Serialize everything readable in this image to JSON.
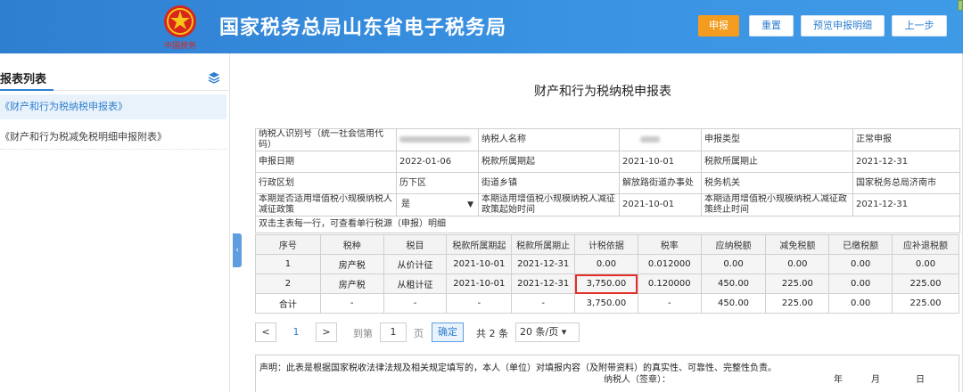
{
  "header": {
    "title": "国家税务总局山东省电子税务局",
    "emblem_text": "中国税务",
    "buttons": [
      {
        "label": "申报"
      },
      {
        "label": "重置"
      },
      {
        "label": "预览申报明细"
      },
      {
        "label": "上一步"
      }
    ]
  },
  "sidebar": {
    "title": "报表列表",
    "items": [
      {
        "label": "《财产和行为税纳税申报表》"
      },
      {
        "label": "《财产和行为税减免税明细申报附表》"
      }
    ]
  },
  "form": {
    "title": "财产和行为税纳税申报表",
    "info": {
      "taxpayer_id_label": "纳税人识别号（统一社会信用代码）",
      "taxpayer_name_label": "纳税人名称",
      "declare_type_label": "申报类型",
      "declare_type_value": "正常申报",
      "declare_date_label": "申报日期",
      "declare_date_value": "2022-01-06",
      "period_start_label": "税款所属期起",
      "period_start_value": "2021-10-01",
      "period_end_label": "税款所属期止",
      "period_end_value": "2021-12-31",
      "district_label": "行政区划",
      "district_value": "历下区",
      "street_label": "街道乡镇",
      "street_value": "解放路街道办事处",
      "authority_label": "税务机关",
      "authority_value": "国家税务总局济南市",
      "small_scale_label": "本期是否适用增值税小规模纳税人减征政策",
      "small_scale_value": "是",
      "reduce_start_label": "本期适用增值税小规模纳税人减征政策起始时间",
      "reduce_start_value": "2021-10-01",
      "reduce_end_label": "本期适用增值税小规模纳税人减征政策终止时间",
      "reduce_end_value": "2021-12-31",
      "hint": "双击主表每一行，可查看单行税源（申报）明细"
    },
    "grid": {
      "headers": [
        "序号",
        "税种",
        "税目",
        "税款所属期起",
        "税款所属期止",
        "计税依据",
        "税率",
        "应纳税额",
        "减免税额",
        "已缴税额",
        "应补退税额"
      ],
      "rows": [
        [
          "1",
          "房产税",
          "从价计征",
          "2021-10-01",
          "2021-12-31",
          "0.00",
          "0.012000",
          "0.00",
          "0.00",
          "0.00",
          "0.00"
        ],
        [
          "2",
          "房产税",
          "从租计征",
          "2021-10-01",
          "2021-12-31",
          "3,750.00",
          "0.120000",
          "450.00",
          "225.00",
          "0.00",
          "225.00"
        ],
        [
          "合计",
          "-",
          "-",
          "-",
          "-",
          "3,750.00",
          "-",
          "450.00",
          "225.00",
          "0.00",
          "225.00"
        ]
      ]
    },
    "pager": {
      "prev": "<",
      "current": "1",
      "next": ">",
      "goto_label": "到第",
      "goto_value": "1",
      "page_label": "页",
      "confirm": "确定",
      "total": "共 2 条",
      "page_size": "20 条/页"
    },
    "declaration": {
      "text": "声明：此表是根据国家税收法律法规及相关规定填写的，本人（单位）对填报内容（及附带资料）的真实性、可靠性、完整性负责。",
      "signer": "纳税人（签章）：",
      "year": "年",
      "month": "月",
      "day": "日"
    }
  },
  "colors": {
    "header_blue": "#3a93e3",
    "accent_orange": "#f39c1f",
    "highlight_red": "#e0322b"
  }
}
